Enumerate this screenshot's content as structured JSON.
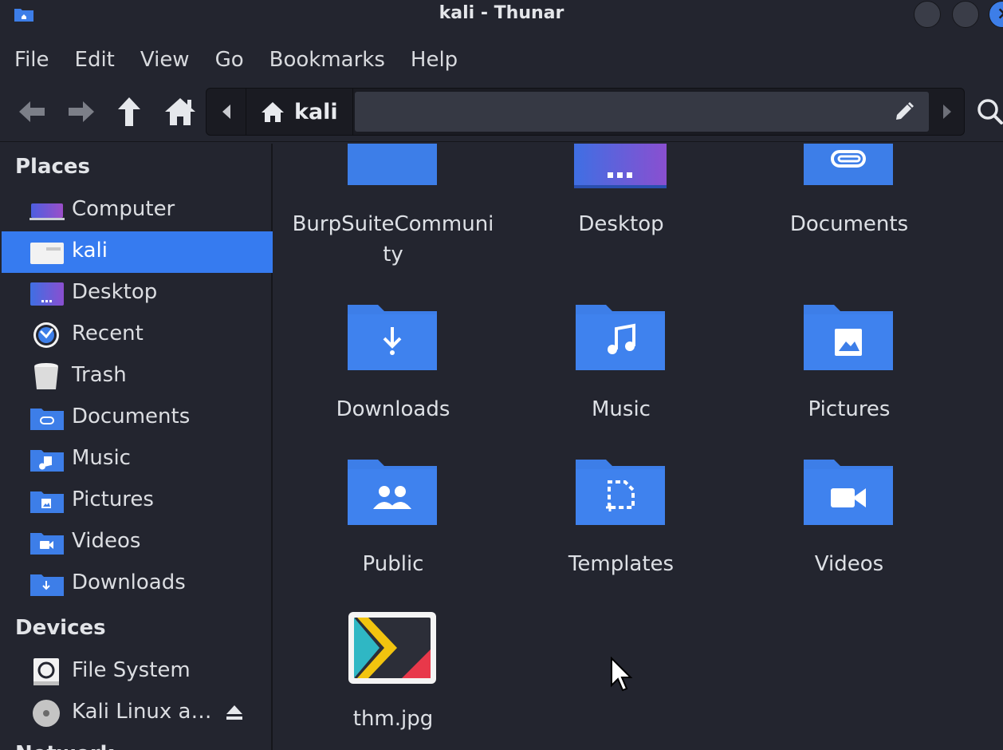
{
  "window": {
    "title": "kali - Thunar"
  },
  "menubar": [
    "File",
    "Edit",
    "View",
    "Go",
    "Bookmarks",
    "Help"
  ],
  "location": {
    "crumb": "kali"
  },
  "sidebar": {
    "places_header": "Places",
    "places": [
      {
        "label": "Computer",
        "icon": "computer-icon"
      },
      {
        "label": "kali",
        "icon": "home-folder-icon",
        "selected": true
      },
      {
        "label": "Desktop",
        "icon": "desktop-icon"
      },
      {
        "label": "Recent",
        "icon": "recent-clock-icon"
      },
      {
        "label": "Trash",
        "icon": "trash-icon"
      },
      {
        "label": "Documents",
        "icon": "documents-folder-icon"
      },
      {
        "label": "Music",
        "icon": "music-folder-icon"
      },
      {
        "label": "Pictures",
        "icon": "pictures-folder-icon"
      },
      {
        "label": "Videos",
        "icon": "videos-folder-icon"
      },
      {
        "label": "Downloads",
        "icon": "downloads-folder-icon"
      }
    ],
    "devices_header": "Devices",
    "devices": [
      {
        "label": "File System",
        "icon": "harddisk-icon"
      },
      {
        "label": "Kali Linux a…",
        "icon": "optical-disc-icon"
      }
    ],
    "network_header": "Network"
  },
  "files": [
    {
      "label": "BurpSuiteCommuni\nty",
      "icon": "folder-icon"
    },
    {
      "label": "Desktop",
      "icon": "desktop-folder-icon"
    },
    {
      "label": "Documents",
      "icon": "documents-folder-icon"
    },
    {
      "label": "Downloads",
      "icon": "downloads-folder-icon"
    },
    {
      "label": "Music",
      "icon": "music-folder-icon"
    },
    {
      "label": "Pictures",
      "icon": "pictures-folder-icon"
    },
    {
      "label": "Public",
      "icon": "public-folder-icon"
    },
    {
      "label": "Templates",
      "icon": "templates-folder-icon"
    },
    {
      "label": "Videos",
      "icon": "videos-folder-icon"
    },
    {
      "label": "thm.jpg",
      "icon": "image-file-icon"
    }
  ],
  "colors": {
    "accent": "#367bf0",
    "folder": "#3d7ee8",
    "background": "#23252f"
  }
}
